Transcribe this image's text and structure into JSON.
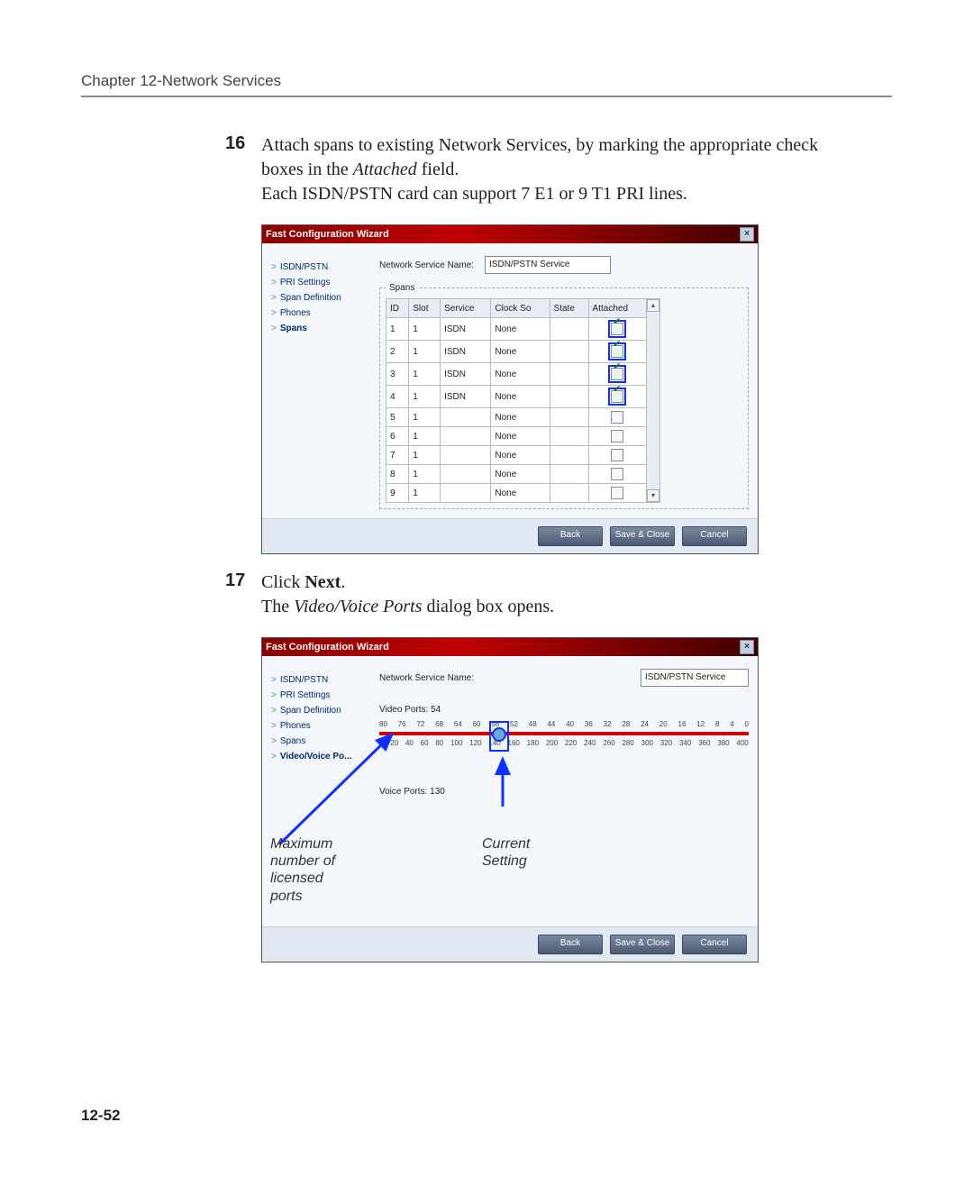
{
  "chapter_header": "Chapter 12-Network Services",
  "step16": {
    "num": "16",
    "line1a": "Attach spans to existing Network Services, by marking the appropriate check boxes in the ",
    "line1b": "Attached",
    "line1c": " field.",
    "line2": "Each ISDN/PSTN card can support 7 E1 or 9 T1 PRI lines."
  },
  "wizard1": {
    "title": "Fast Configuration Wizard",
    "close": "×",
    "sidebar": [
      "ISDN/PSTN",
      "PRI Settings",
      "Span Definition",
      "Phones",
      "Spans"
    ],
    "active_index": 4,
    "svc_label": "Network Service Name:",
    "svc_value": "ISDN/PSTN Service",
    "legend": "Spans",
    "cols": [
      "ID",
      "Slot",
      "Service",
      "Clock So",
      "State",
      "Attached"
    ],
    "rows": [
      {
        "id": "1",
        "slot": "1",
        "service": "ISDN",
        "clock": "None",
        "state": "",
        "attached": true,
        "hl": true
      },
      {
        "id": "2",
        "slot": "1",
        "service": "ISDN",
        "clock": "None",
        "state": "",
        "attached": true,
        "hl": true
      },
      {
        "id": "3",
        "slot": "1",
        "service": "ISDN",
        "clock": "None",
        "state": "",
        "attached": true,
        "hl": true
      },
      {
        "id": "4",
        "slot": "1",
        "service": "ISDN",
        "clock": "None",
        "state": "",
        "attached": true,
        "hl": true
      },
      {
        "id": "5",
        "slot": "1",
        "service": "",
        "clock": "None",
        "state": "",
        "attached": false,
        "hl": false
      },
      {
        "id": "6",
        "slot": "1",
        "service": "",
        "clock": "None",
        "state": "",
        "attached": false,
        "hl": false
      },
      {
        "id": "7",
        "slot": "1",
        "service": "",
        "clock": "None",
        "state": "",
        "attached": false,
        "hl": false
      },
      {
        "id": "8",
        "slot": "1",
        "service": "",
        "clock": "None",
        "state": "",
        "attached": false,
        "hl": false
      },
      {
        "id": "9",
        "slot": "1",
        "service": "",
        "clock": "None",
        "state": "",
        "attached": false,
        "hl": false
      }
    ],
    "buttons": {
      "back": "Back",
      "save": "Save & Close",
      "cancel": "Cancel"
    }
  },
  "step17": {
    "num": "17",
    "line1a": "Click ",
    "line1b": "Next",
    "line1c": ".",
    "line2a": "The ",
    "line2b": "Video/Voice Ports",
    "line2c": " dialog box opens."
  },
  "wizard2": {
    "title": "Fast Configuration Wizard",
    "close": "×",
    "sidebar": [
      "ISDN/PSTN",
      "PRI Settings",
      "Span Definition",
      "Phones",
      "Spans",
      "Video/Voice Po..."
    ],
    "active_index": 5,
    "svc_label": "Network Service Name:",
    "svc_value": "ISDN/PSTN Service",
    "video_label": "Video Ports: 54",
    "voice_label": "Voice Ports: 130",
    "ticks_top": [
      "80",
      "76",
      "72",
      "68",
      "64",
      "60",
      "56",
      "52",
      "48",
      "44",
      "40",
      "36",
      "32",
      "28",
      "24",
      "20",
      "16",
      "12",
      "8",
      "4",
      "0"
    ],
    "ticks_bottom": [
      "0",
      "20",
      "40",
      "60",
      "80",
      "100",
      "120",
      "140",
      "160",
      "180",
      "200",
      "220",
      "240",
      "260",
      "280",
      "300",
      "320",
      "340",
      "360",
      "380",
      "400"
    ],
    "buttons": {
      "back": "Back",
      "save": "Save & Close",
      "cancel": "Cancel"
    }
  },
  "annotations": {
    "max": "Maximum\nnumber of\nlicensed\nports",
    "cur": "Current\nSetting"
  },
  "page_number": "12-52",
  "chart_data": {
    "type": "table",
    "title": "Spans",
    "columns": [
      "ID",
      "Slot",
      "Service",
      "Clock Source",
      "State",
      "Attached"
    ],
    "rows": [
      [
        1,
        1,
        "ISDN",
        "None",
        "",
        true
      ],
      [
        2,
        1,
        "ISDN",
        "None",
        "",
        true
      ],
      [
        3,
        1,
        "ISDN",
        "None",
        "",
        true
      ],
      [
        4,
        1,
        "ISDN",
        "None",
        "",
        true
      ],
      [
        5,
        1,
        "",
        "None",
        "",
        false
      ],
      [
        6,
        1,
        "",
        "None",
        "",
        false
      ],
      [
        7,
        1,
        "",
        "None",
        "",
        false
      ],
      [
        8,
        1,
        "",
        "None",
        "",
        false
      ],
      [
        9,
        1,
        "",
        "None",
        "",
        false
      ]
    ],
    "slider": {
      "video_ports": 54,
      "video_range": [
        0,
        80
      ],
      "voice_ports": 130,
      "voice_range": [
        0,
        400
      ]
    }
  }
}
